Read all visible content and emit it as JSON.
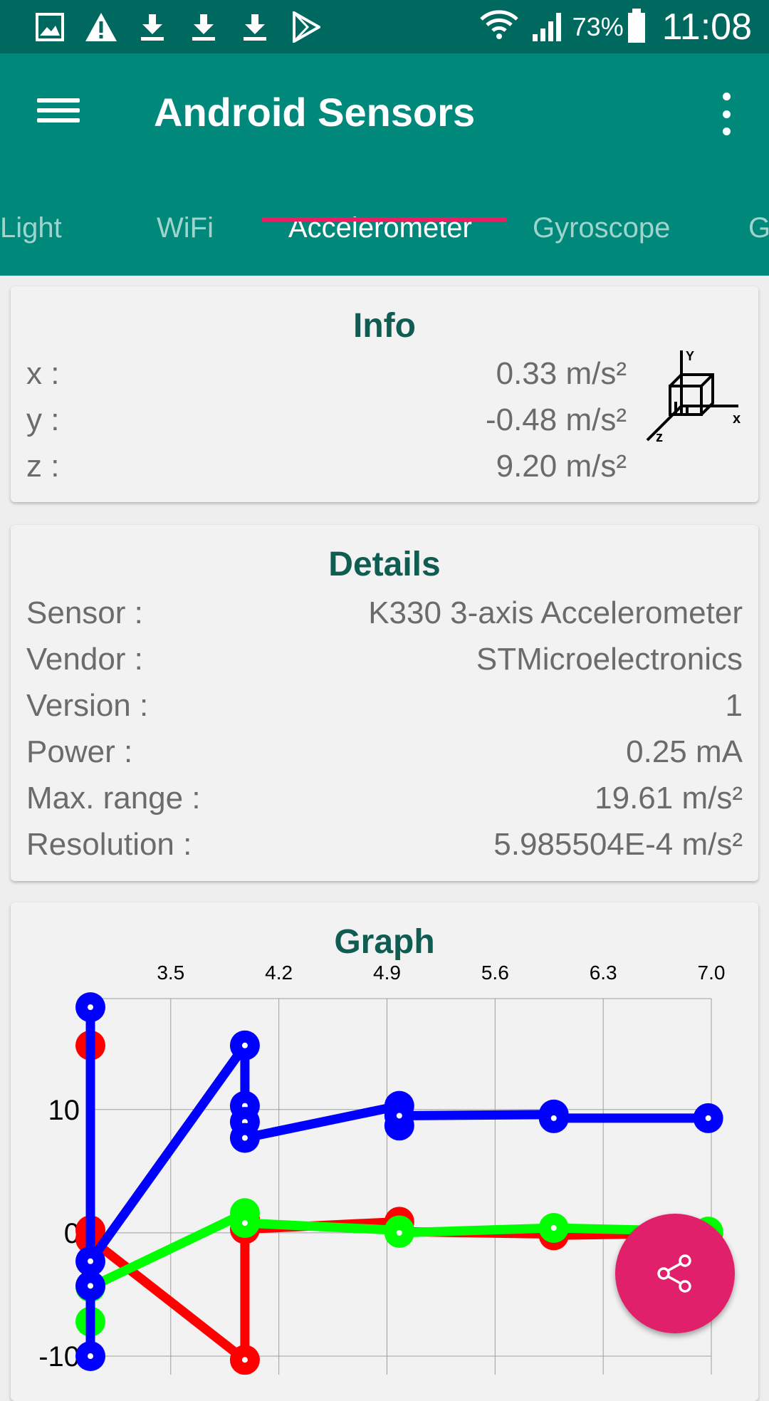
{
  "status_bar": {
    "left_icons": [
      "image-icon",
      "warning-icon",
      "download-icon",
      "download-icon",
      "download-icon",
      "play-store-icon"
    ],
    "battery_percent": "73%",
    "time": "11:08"
  },
  "app_bar": {
    "title": "Android Sensors"
  },
  "tabs": [
    {
      "label": "Light",
      "active": false
    },
    {
      "label": "WiFi",
      "active": false
    },
    {
      "label": "Accelerometer",
      "active": true
    },
    {
      "label": "Gyroscope",
      "active": false
    },
    {
      "label": "G",
      "active": false
    }
  ],
  "info": {
    "title": "Info",
    "rows": [
      {
        "label": "x :",
        "value": "0.33 m/s²"
      },
      {
        "label": "y :",
        "value": "-0.48 m/s²"
      },
      {
        "label": "z :",
        "value": "9.20 m/s²"
      }
    ],
    "axis_icon_labels": {
      "y": "Y",
      "x": "x",
      "z": "z"
    }
  },
  "details": {
    "title": "Details",
    "rows": [
      {
        "label": "Sensor :",
        "value": "K330 3-axis Accelerometer"
      },
      {
        "label": "Vendor :",
        "value": "STMicroelectronics"
      },
      {
        "label": "Version :",
        "value": "1"
      },
      {
        "label": "Power :",
        "value": "0.25 mA"
      },
      {
        "label": "Max. range :",
        "value": "19.61 m/s²"
      },
      {
        "label": "Resolution :",
        "value": "5.985504E-4 m/s²"
      }
    ]
  },
  "graph": {
    "title": "Graph"
  },
  "colors": {
    "status_bar": "#00695f",
    "app_bar": "#00897b",
    "tab_indicator": "#e91e63",
    "card_title": "#0f5c52",
    "fab": "#e0206a",
    "series_x": "#ff0000",
    "series_y": "#00ff00",
    "series_z": "#0000ff"
  },
  "chart_data": {
    "type": "line",
    "title": "Graph",
    "x_ticks": [
      "3.5",
      "4.2",
      "4.9",
      "5.6",
      "6.3",
      "7.0"
    ],
    "y_ticks": [
      "10",
      "0",
      "-10"
    ],
    "xlim": [
      2.98,
      7.0
    ],
    "ylim": [
      -11.5,
      19.0
    ],
    "grid": true,
    "series": [
      {
        "color": "#ff0000",
        "points": [
          [
            2.98,
            15.2
          ],
          [
            2.98,
            0.2
          ],
          [
            2.98,
            -0.5
          ],
          [
            3.98,
            -10.3
          ],
          [
            3.98,
            1.2
          ],
          [
            3.98,
            0.3
          ],
          [
            4.98,
            0.9
          ],
          [
            4.98,
            0.1
          ],
          [
            5.98,
            -0.1
          ],
          [
            5.98,
            -0.2
          ],
          [
            6.98,
            0.0
          ]
        ]
      },
      {
        "color": "#00ff00",
        "points": [
          [
            2.98,
            -7.2
          ],
          [
            2.98,
            -4.4
          ],
          [
            3.98,
            1.6
          ],
          [
            3.98,
            0.8
          ],
          [
            4.98,
            0.2
          ],
          [
            4.98,
            0.0
          ],
          [
            5.98,
            0.4
          ],
          [
            6.98,
            0.1
          ]
        ]
      },
      {
        "color": "#0000ff",
        "points": [
          [
            2.98,
            18.3
          ],
          [
            2.98,
            -10.0
          ],
          [
            2.98,
            -4.3
          ],
          [
            2.98,
            -2.3
          ],
          [
            3.98,
            15.2
          ],
          [
            3.98,
            10.3
          ],
          [
            3.98,
            9.0
          ],
          [
            3.98,
            7.7
          ],
          [
            4.98,
            10.3
          ],
          [
            4.98,
            8.7
          ],
          [
            4.98,
            9.5
          ],
          [
            5.98,
            9.6
          ],
          [
            5.98,
            9.3
          ],
          [
            6.98,
            9.3
          ]
        ]
      }
    ]
  },
  "fab": {
    "icon": "share-icon"
  }
}
